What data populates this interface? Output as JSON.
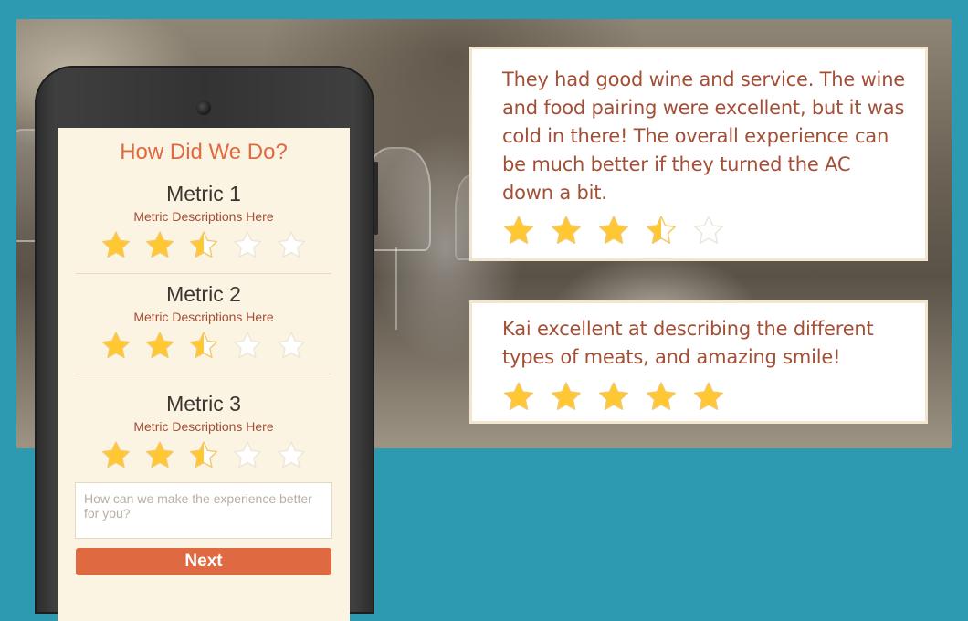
{
  "banner": {
    "image": "restaurant-table-photo"
  },
  "reviews": [
    {
      "text": "They had good wine and service. The wine and food pairing were excellent, but it was cold in there! The overall experience can be much better if they turned the AC down a bit.",
      "rating": 3.5,
      "max": 5
    },
    {
      "text": "Kai excellent at describing the different types of meats, and amazing smile!",
      "rating": 5,
      "max": 5
    }
  ],
  "survey": {
    "title": "How Did We Do?",
    "metrics": [
      {
        "title": "Metric 1",
        "description": "Metric Descriptions Here",
        "rating": 2.5,
        "max": 5
      },
      {
        "title": "Metric 2",
        "description": "Metric Descriptions Here",
        "rating": 2.5,
        "max": 5
      },
      {
        "title": "Metric 3",
        "description": "Metric Descriptions Here",
        "rating": 2.5,
        "max": 5
      }
    ],
    "feedback_placeholder": "How can we make the experience better for you?",
    "next_label": "Next"
  },
  "colors": {
    "background": "#2e9ab2",
    "accent": "#df6a42",
    "review_text": "#a34f36",
    "star_fill": "#ffc832",
    "star_outline": "#ece6da"
  },
  "icons": {
    "star": "star-icon",
    "half_star": "star-half-icon",
    "empty_star": "star-empty-icon"
  }
}
